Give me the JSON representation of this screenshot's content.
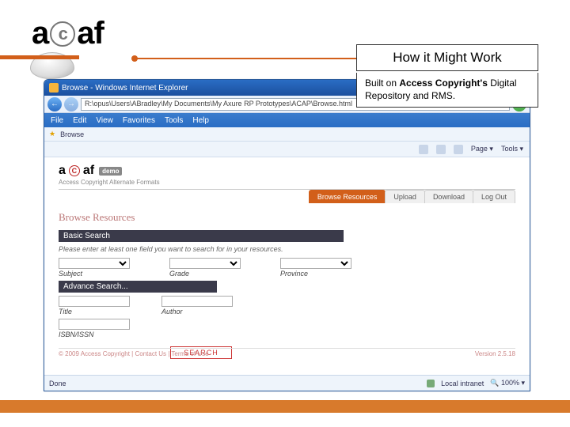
{
  "slide": {
    "logo_a1": "a",
    "logo_c": "c",
    "logo_a2": "af",
    "headline": "How it Might Work",
    "subhead_pre": "Built on ",
    "subhead_bold": "Access Copyright's",
    "subhead_post": " Digital Repository and RMS."
  },
  "ie": {
    "title": "Browse - Windows Internet Explorer",
    "address": "R:\\opus\\Users\\ABradley\\My Documents\\My Axure RP Prototypes\\ACAP\\Browse.html",
    "menu": [
      "File",
      "Edit",
      "View",
      "Favorites",
      "Tools",
      "Help"
    ],
    "links_label": "Browse",
    "toolbar": {
      "home": "",
      "page": "Page",
      "tools": "Tools"
    },
    "status_left": "Done",
    "status_zone": "Local intranet",
    "status_zoom": "100%"
  },
  "app": {
    "logo": {
      "a1": "a",
      "c": "C",
      "a2": "af",
      "badge": "demo"
    },
    "tagline": "Access Copyright Alternate Formats",
    "tabs": [
      "Browse Resources",
      "Upload",
      "Download",
      "Log Out"
    ],
    "page_title": "Browse Resources",
    "basic_label": "Basic Search",
    "basic_hint": "Please enter at least one field you want to search for in your resources.",
    "basic_fields": {
      "subject": "Subject",
      "grade": "Grade",
      "province": "Province"
    },
    "adv_label": "Advance Search...",
    "adv_fields": {
      "title": "Title",
      "author": "Author",
      "isbn": "ISBN/ISSN"
    },
    "search_btn": "SEARCH",
    "footer_left": "© 2009 Access Copyright | Contact Us | Terms of Use",
    "footer_right": "Version 2.5.18"
  }
}
